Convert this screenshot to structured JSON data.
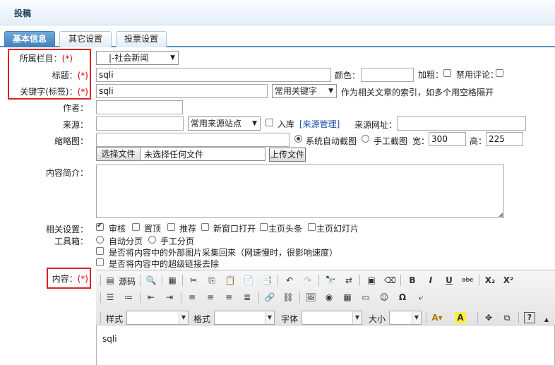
{
  "page": {
    "title": "投稿"
  },
  "tabs": [
    {
      "label": "基本信息"
    },
    {
      "label": "其它设置"
    },
    {
      "label": "投票设置"
    }
  ],
  "form": {
    "column_label": "所属栏目：",
    "column_value": "|-社会新闻",
    "title_label": "标题：",
    "title_value": "sqli",
    "color_label": "颜色：",
    "bold_label": "加粗：",
    "disable_comment_label": "禁用评论：",
    "keywords_label": "关键字(标签)：",
    "keywords_value": "sqli",
    "common_keywords": "常用关键字",
    "keywords_hint": "作为相关文章的索引，如多个用空格隔开",
    "author_label": "作者：",
    "source_label": "来源：",
    "common_source": "常用来源站点",
    "save_library_label": "入库",
    "source_manage_link": "[来源管理]",
    "source_url_label": "来源网址：",
    "thumb_label": "缩略图：",
    "auto_crop_label": "系统自动截图",
    "manual_crop_label": "手工截图",
    "width_label": "宽：",
    "width_value": "300",
    "height_label": "高：",
    "height_value": "225",
    "choose_file_label": "选择文件",
    "no_file_label": "未选择任何文件",
    "upload_label": "上传文件",
    "summary_label": "内容简介：",
    "related_label": "相关设置：",
    "related_options": [
      "审核",
      "置顶",
      "推荐",
      "新窗口打开",
      "主页头条",
      "主页幻灯片"
    ],
    "tools_label": "工具箱：",
    "auto_page_label": "自动分页",
    "manual_page_label": "手工分页",
    "collect_images_label": "是否将内容中的外部图片采集回来（网速慢时，很影响速度）",
    "remove_links_label": "是否将内容中的超级链接去除",
    "content_label": "内容：",
    "required_mark": "(*)"
  },
  "editor": {
    "source_label": "源码",
    "style_label": "样式",
    "format_label": "格式",
    "font_label": "字体",
    "size_label": "大小",
    "content_text": "sqli"
  },
  "colors": {
    "tab_active": "#4f92c8",
    "required": "#d00000",
    "highlight_box": "#e02020"
  }
}
